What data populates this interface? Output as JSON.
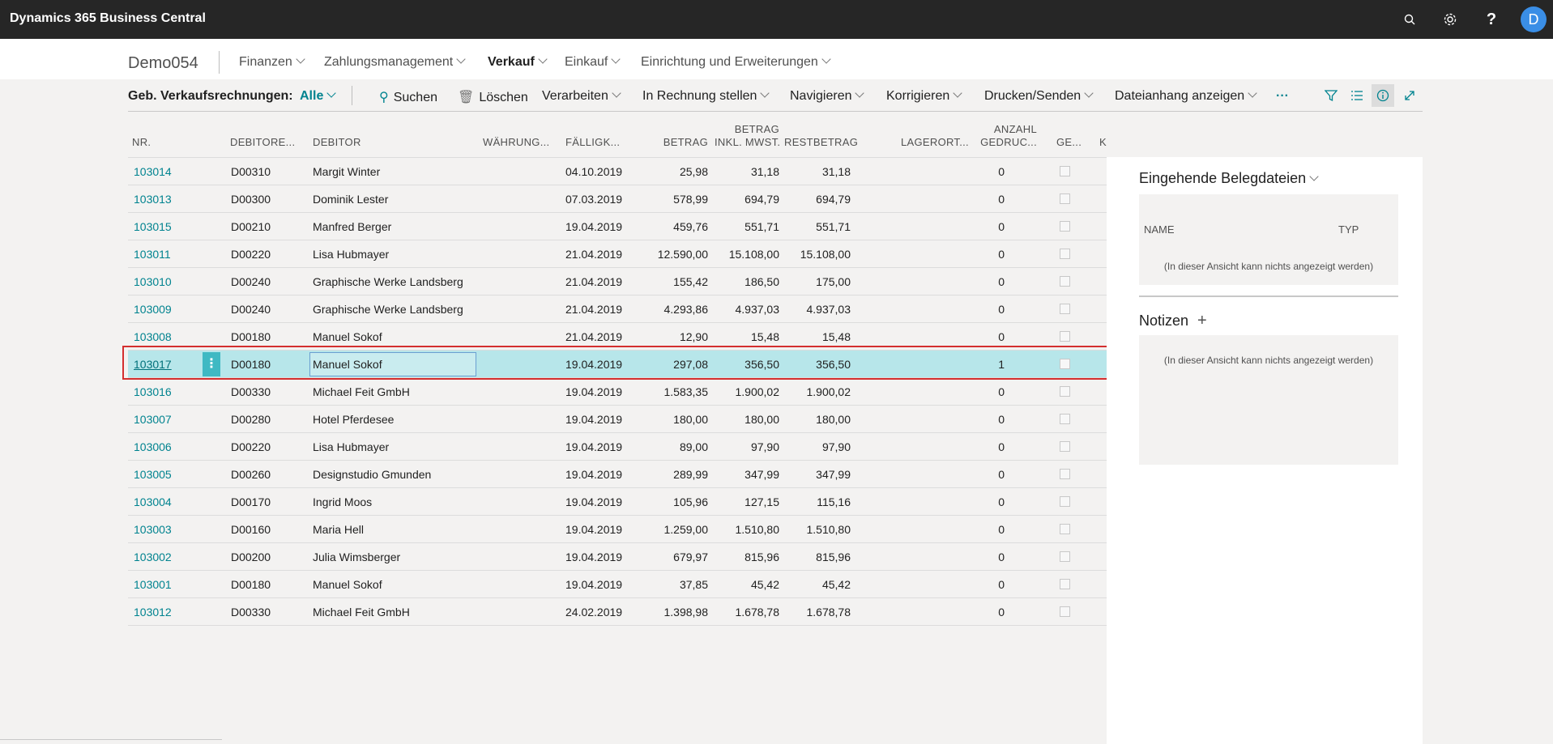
{
  "app": {
    "title": "Dynamics 365 Business Central",
    "user_initial": "D"
  },
  "nav": {
    "company": "Demo054",
    "items": [
      "Finanzen",
      "Zahlungsmanagement",
      "Verkauf",
      "Einkauf",
      "Einrichtung und Erweiterungen"
    ]
  },
  "actionbar": {
    "title": "Geb. Verkaufsrechnungen:",
    "filter": "Alle",
    "search": "Suchen",
    "delete": "Löschen",
    "process": "Verarbeiten",
    "invoice": "In Rechnung stellen",
    "navigate": "Navigieren",
    "correct": "Korrigieren",
    "print": "Drucken/Senden",
    "attachment": "Dateianhang anzeigen",
    "more": "···"
  },
  "table": {
    "headers": {
      "nr": "NR.",
      "debitor_nr": "DEBITORE...",
      "debitor": "DEBITOR",
      "currency": "WÄHRUNG...",
      "due": "FÄLLIGK...",
      "amount": "BETRAG",
      "amount_vat_1": "BETRAG",
      "amount_vat_2": "INKL. MWST.",
      "remaining": "RESTBETRAG",
      "location": "LAGERORT...",
      "printed_1": "ANZAHL",
      "printed_2": "GEDRUC...",
      "ge": "GE...",
      "k": "K"
    },
    "rows": [
      {
        "nr": "103014",
        "deb": "D00310",
        "name": "Margit Winter",
        "due": "04.10.2019",
        "amount": "25,98",
        "vat": "31,18",
        "rest": "31,18",
        "count": "0"
      },
      {
        "nr": "103013",
        "deb": "D00300",
        "name": "Dominik Lester",
        "due": "07.03.2019",
        "amount": "578,99",
        "vat": "694,79",
        "rest": "694,79",
        "count": "0"
      },
      {
        "nr": "103015",
        "deb": "D00210",
        "name": "Manfred Berger",
        "due": "19.04.2019",
        "amount": "459,76",
        "vat": "551,71",
        "rest": "551,71",
        "count": "0"
      },
      {
        "nr": "103011",
        "deb": "D00220",
        "name": "Lisa Hubmayer",
        "due": "21.04.2019",
        "amount": "12.590,00",
        "vat": "15.108,00",
        "rest": "15.108,00",
        "count": "0"
      },
      {
        "nr": "103010",
        "deb": "D00240",
        "name": "Graphische Werke Landsberg",
        "due": "21.04.2019",
        "amount": "155,42",
        "vat": "186,50",
        "rest": "175,00",
        "count": "0"
      },
      {
        "nr": "103009",
        "deb": "D00240",
        "name": "Graphische Werke Landsberg",
        "due": "21.04.2019",
        "amount": "4.293,86",
        "vat": "4.937,03",
        "rest": "4.937,03",
        "count": "0"
      },
      {
        "nr": "103008",
        "deb": "D00180",
        "name": "Manuel Sokof",
        "due": "21.04.2019",
        "amount": "12,90",
        "vat": "15,48",
        "rest": "15,48",
        "count": "0"
      },
      {
        "nr": "103017",
        "deb": "D00180",
        "name": "Manuel Sokof",
        "due": "19.04.2019",
        "amount": "297,08",
        "vat": "356,50",
        "rest": "356,50",
        "count": "1"
      },
      {
        "nr": "103016",
        "deb": "D00330",
        "name": "Michael Feit GmbH",
        "due": "19.04.2019",
        "amount": "1.583,35",
        "vat": "1.900,02",
        "rest": "1.900,02",
        "count": "0"
      },
      {
        "nr": "103007",
        "deb": "D00280",
        "name": "Hotel Pferdesee",
        "due": "19.04.2019",
        "amount": "180,00",
        "vat": "180,00",
        "rest": "180,00",
        "count": "0"
      },
      {
        "nr": "103006",
        "deb": "D00220",
        "name": "Lisa Hubmayer",
        "due": "19.04.2019",
        "amount": "89,00",
        "vat": "97,90",
        "rest": "97,90",
        "count": "0"
      },
      {
        "nr": "103005",
        "deb": "D00260",
        "name": "Designstudio Gmunden",
        "due": "19.04.2019",
        "amount": "289,99",
        "vat": "347,99",
        "rest": "347,99",
        "count": "0"
      },
      {
        "nr": "103004",
        "deb": "D00170",
        "name": "Ingrid Moos",
        "due": "19.04.2019",
        "amount": "105,96",
        "vat": "127,15",
        "rest": "115,16",
        "count": "0"
      },
      {
        "nr": "103003",
        "deb": "D00160",
        "name": "Maria Hell",
        "due": "19.04.2019",
        "amount": "1.259,00",
        "vat": "1.510,80",
        "rest": "1.510,80",
        "count": "0"
      },
      {
        "nr": "103002",
        "deb": "D00200",
        "name": "Julia Wimsberger",
        "due": "19.04.2019",
        "amount": "679,97",
        "vat": "815,96",
        "rest": "815,96",
        "count": "0"
      },
      {
        "nr": "103001",
        "deb": "D00180",
        "name": "Manuel Sokof",
        "due": "19.04.2019",
        "amount": "37,85",
        "vat": "45,42",
        "rest": "45,42",
        "count": "0"
      },
      {
        "nr": "103012",
        "deb": "D00330",
        "name": "Michael Feit GmbH",
        "due": "24.02.2019",
        "amount": "1.398,98",
        "vat": "1.678,78",
        "rest": "1.678,78",
        "count": "0"
      }
    ],
    "selected_row": 7
  },
  "factbox": {
    "docs_title": "Eingehende Belegdateien",
    "col_name": "NAME",
    "col_type": "TYP",
    "docs_empty": "(In dieser Ansicht kann nichts angezeigt werden)",
    "notes_title": "Notizen",
    "notes_add": "+",
    "notes_empty": "(In dieser Ansicht kann nichts angezeigt werden)"
  },
  "colors": {
    "accent": "#00838f",
    "selected_row": "#b7e6ea",
    "highlight_border": "#d32f2f",
    "topbar": "#262626"
  }
}
